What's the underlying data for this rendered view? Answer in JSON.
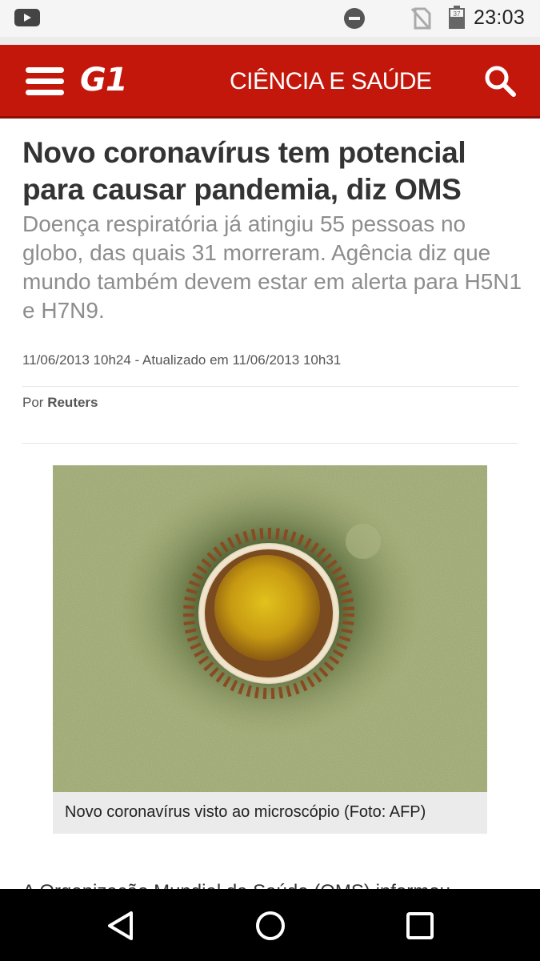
{
  "status_bar": {
    "time": "23:03",
    "battery_level": "37",
    "icons": [
      "youtube-icon",
      "do-not-disturb-icon",
      "no-sim-icon",
      "battery-icon"
    ]
  },
  "header": {
    "logo": "G1",
    "section": "CIÊNCIA E SAÚDE",
    "icons": [
      "menu-icon",
      "search-icon"
    ],
    "brand_color": "#c4170c"
  },
  "article": {
    "headline": "Novo coronavírus tem potencial para causar pandemia, diz OMS",
    "subtitle": "Doença respiratória já atingiu 55 pessoas no globo, das quais 31 morreram. Agência diz que mundo também devem estar em alerta para H5N1 e H7N9.",
    "dateline": "11/06/2013 10h24 - Atualizado em 11/06/2013 10h31",
    "byline_prefix": "Por",
    "byline_author": "Reuters",
    "photo_caption": "Novo coronavírus visto ao microscópio (Foto: AFP)",
    "body_start": "A Organização Mundial da Saúde (OMS) informou"
  },
  "nav_bar": {
    "icons": [
      "back-icon",
      "home-icon",
      "recent-apps-icon"
    ]
  }
}
